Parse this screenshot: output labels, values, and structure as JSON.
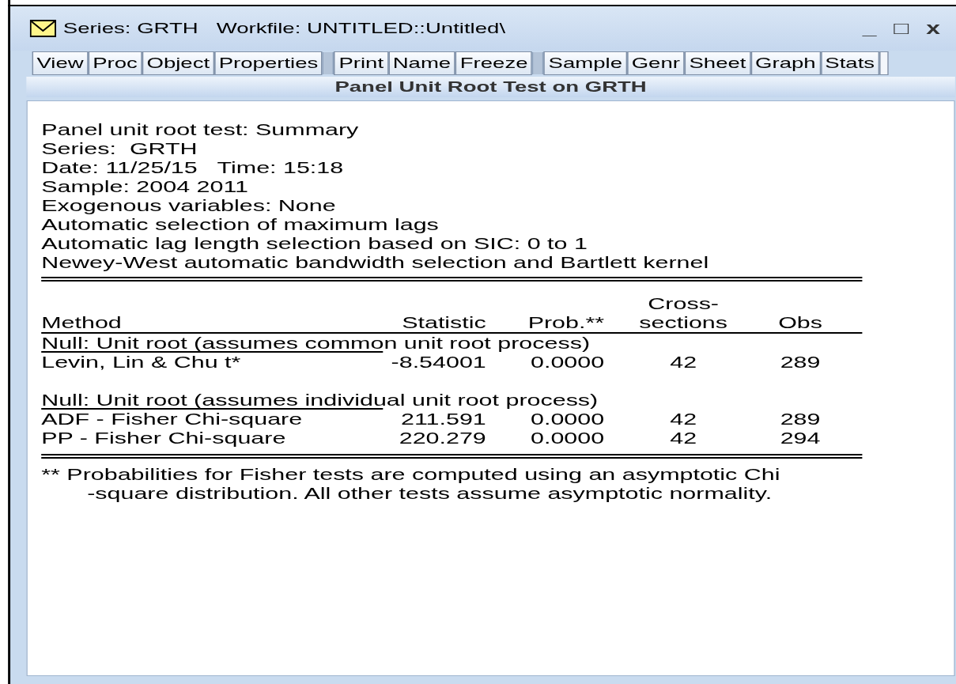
{
  "window": {
    "title": "Series: GRTH   Workfile: UNTITLED::Untitled\\",
    "controls": [
      "_",
      "□",
      "x"
    ]
  },
  "toolbar": {
    "groups": [
      [
        "View",
        "Proc",
        "Object",
        "Properties"
      ],
      [
        "Print",
        "Name",
        "Freeze"
      ],
      [
        "Sample",
        "Genr",
        "Sheet",
        "Graph",
        "Stats"
      ]
    ]
  },
  "header": "Panel Unit Root Test on GRTH",
  "summary_lines": [
    "Panel unit root test: Summary",
    "Series:  GRTH",
    "Date: 11/25/15   Time: 15:18",
    "Sample: 2004 2011",
    "Exogenous variables: None",
    "Automatic selection of maximum lags",
    "Automatic lag length selection based on SIC: 0 to 1",
    "Newey-West automatic bandwidth selection and Bartlett kernel"
  ],
  "table": {
    "columns": [
      "Method",
      "Statistic",
      "Prob.**",
      "Cross-\nsections",
      "Obs"
    ],
    "rows": [
      {
        "kind": "section",
        "text": "Null: Unit root (assumes common unit root process)"
      },
      {
        "kind": "data",
        "cells": [
          "Levin, Lin & Chu t*",
          "-8.54001",
          "0.0000",
          "42",
          "289"
        ]
      },
      {
        "kind": "blank"
      },
      {
        "kind": "section",
        "text": "Null: Unit root (assumes individual unit root process)"
      },
      {
        "kind": "data",
        "cells": [
          "ADF - Fisher Chi-square",
          "211.591",
          "0.0000",
          "42",
          "289"
        ]
      },
      {
        "kind": "data",
        "cells": [
          "PP - Fisher Chi-square",
          "220.279",
          "0.0000",
          "42",
          "294"
        ]
      }
    ]
  },
  "notes": [
    "** Probabilities for Fisher tests are computed using an asymptotic Chi",
    "-square distribution. All other tests assume asymptotic normality."
  ]
}
